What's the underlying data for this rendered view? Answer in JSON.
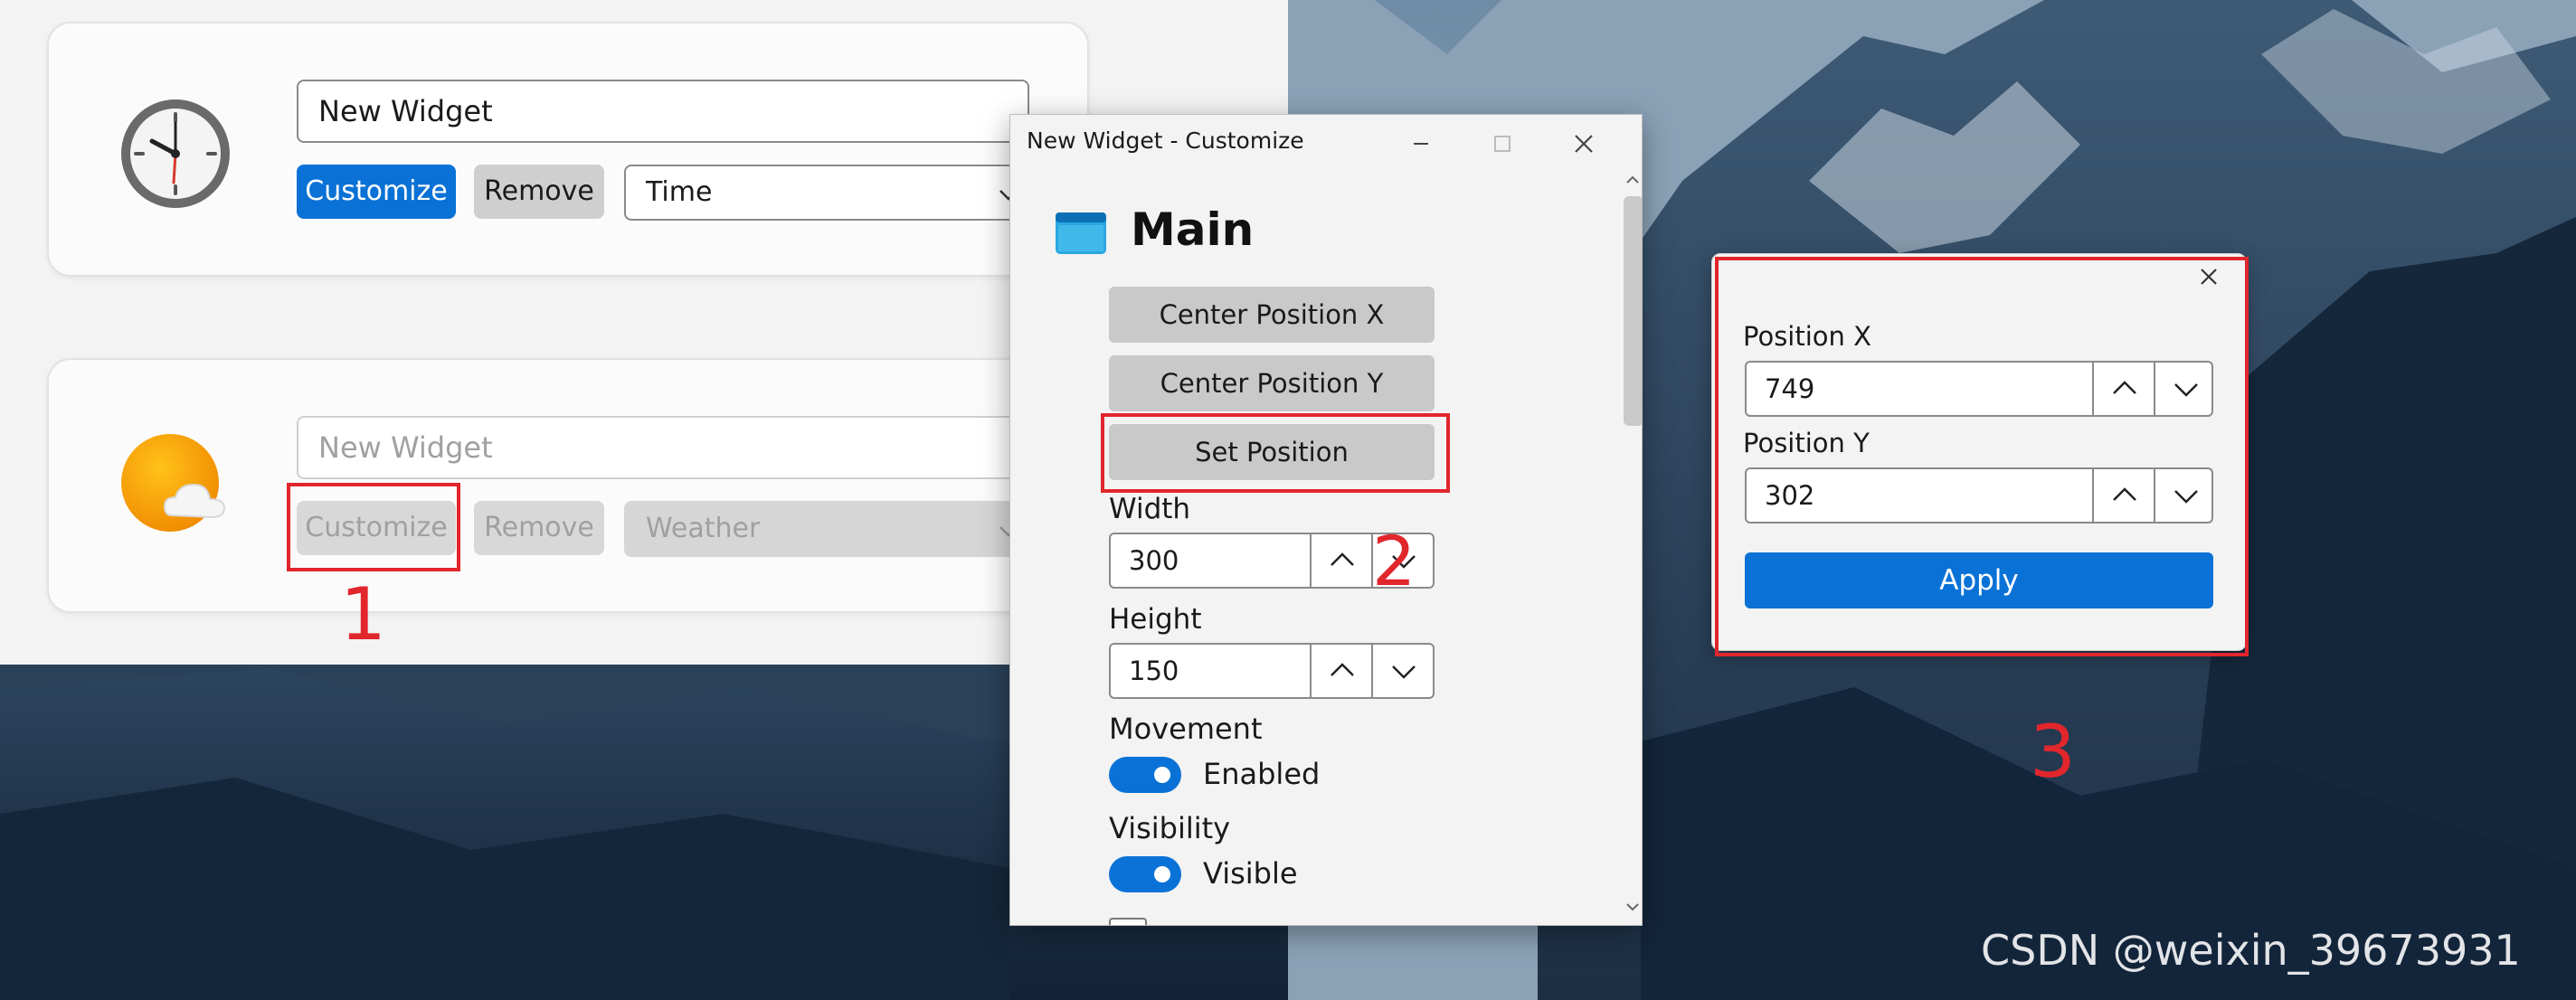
{
  "widgets": [
    {
      "name_value": "New Widget",
      "customize_label": "Customize",
      "remove_label": "Remove",
      "type_selected": "Time",
      "icon": "clock-icon"
    },
    {
      "name_placeholder": "New Widget",
      "customize_label": "Customize",
      "remove_label": "Remove",
      "type_selected": "Weather",
      "icon": "weather-icon"
    }
  ],
  "customize_window": {
    "title": "New Widget - Customize",
    "section_title": "Main",
    "center_x_label": "Center Position X",
    "center_y_label": "Center Position Y",
    "set_position_label": "Set Position",
    "width_label": "Width",
    "width_value": "300",
    "height_label": "Height",
    "height_value": "150",
    "movement_label": "Movement",
    "movement_toggle_label": "Enabled",
    "visibility_label": "Visibility",
    "visibility_toggle_label": "Visible"
  },
  "position_popup": {
    "x_label": "Position X",
    "x_value": "749",
    "y_label": "Position Y",
    "y_value": "302",
    "apply_label": "Apply"
  },
  "annotations": {
    "n1": "1",
    "n2": "2",
    "n3": "3"
  },
  "watermark": "CSDN @weixin_39673931",
  "colors": {
    "accent": "#0a72d6",
    "annotation": "#e1262c"
  }
}
